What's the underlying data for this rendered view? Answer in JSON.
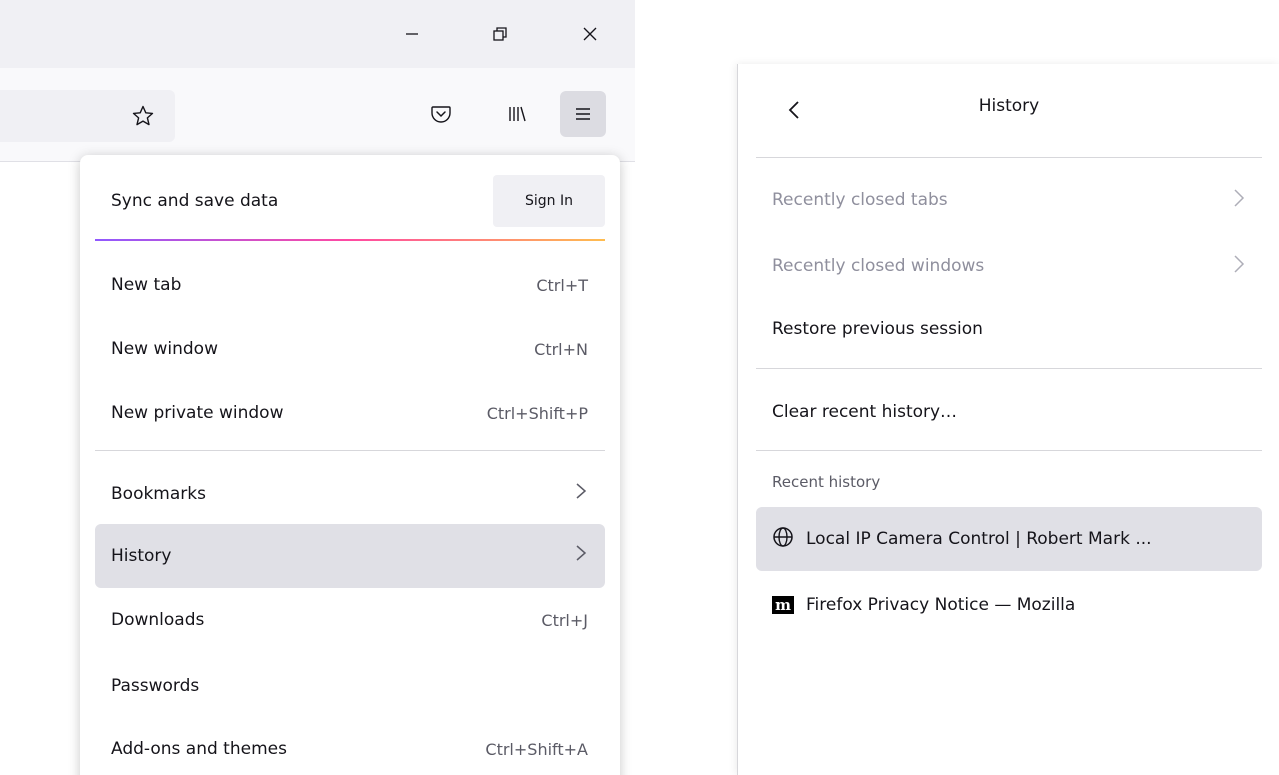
{
  "window_controls": {
    "minimize_icon": "minimize-icon",
    "restore_icon": "restore-icon",
    "close_icon": "close-icon"
  },
  "toolbar": {
    "bookmark_star_icon": "star-icon",
    "pocket_icon": "pocket-icon",
    "library_icon": "library-icon",
    "menu_icon": "hamburger-menu-icon"
  },
  "app_menu": {
    "sync_label": "Sync and save data",
    "sign_in_label": "Sign In",
    "items": [
      {
        "label": "New tab",
        "shortcut": "Ctrl+T"
      },
      {
        "label": "New window",
        "shortcut": "Ctrl+N"
      },
      {
        "label": "New private window",
        "shortcut": "Ctrl+Shift+P"
      },
      {
        "label": "Bookmarks",
        "shortcut": ""
      },
      {
        "label": "History",
        "shortcut": ""
      },
      {
        "label": "Downloads",
        "shortcut": "Ctrl+J"
      },
      {
        "label": "Passwords",
        "shortcut": ""
      },
      {
        "label": "Add-ons and themes",
        "shortcut": "Ctrl+Shift+A"
      }
    ]
  },
  "history_panel": {
    "title": "History",
    "recently_closed_tabs": "Recently closed tabs",
    "recently_closed_windows": "Recently closed windows",
    "restore_previous_session": "Restore previous session",
    "clear_recent_history": "Clear recent history…",
    "recent_history_heading": "Recent history",
    "entries": [
      {
        "title": "Local IP Camera Control | Robert Mark ...",
        "icon": "globe-icon"
      },
      {
        "title": "Firefox Privacy Notice — Mozilla",
        "icon": "mozilla-m-icon",
        "icon_letter": "m"
      }
    ]
  },
  "colors": {
    "highlight": "#e0e0e6",
    "gradient": [
      "#9059ff",
      "#ff4aa2",
      "#ffbd4f"
    ]
  }
}
